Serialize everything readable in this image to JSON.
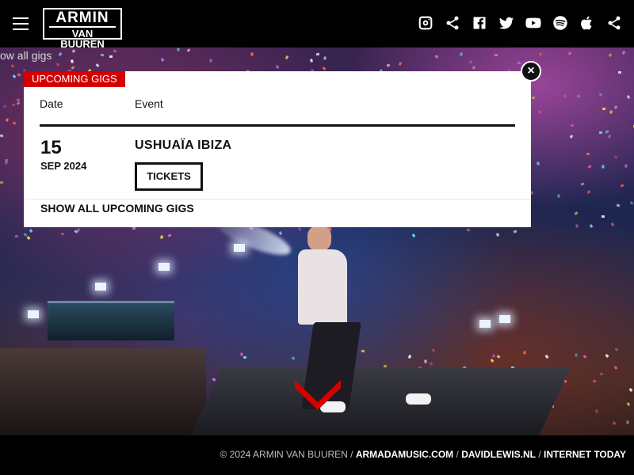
{
  "header": {
    "logo_line1": "ARMIN",
    "logo_line2": "VAN BUUREN",
    "socials": [
      "instagram-icon",
      "share-icon",
      "facebook-icon",
      "twitter-icon",
      "youtube-icon",
      "spotify-icon",
      "apple-icon",
      "share-icon"
    ]
  },
  "hero": {
    "back_link": "ow all gigs"
  },
  "modal": {
    "tag": "UPCOMING GIGS",
    "columns": {
      "date": "Date",
      "event": "Event"
    },
    "gig": {
      "day": "15",
      "month_year": "SEP 2024",
      "venue": "USHUAÏA IBIZA",
      "tickets_label": "TICKETS"
    },
    "show_all": "SHOW ALL UPCOMING GIGS",
    "close": "×"
  },
  "footer": {
    "copyright": "© 2024 ARMIN VAN BUUREN",
    "link1": "ARMADAMUSIC.COM",
    "link2": "DAVIDLEWIS.NL",
    "link3": "INTERNET TODAY"
  },
  "colors": {
    "accent_red": "#d40000",
    "header_bg": "#000000",
    "modal_bg": "#ffffff"
  }
}
